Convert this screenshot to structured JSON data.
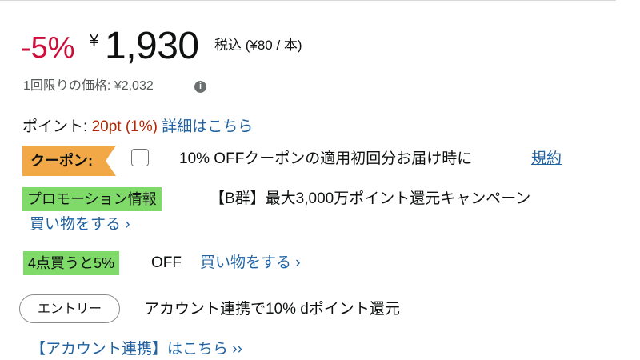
{
  "price": {
    "discount": "-5%",
    "currency_symbol": "¥",
    "amount": "1,930",
    "tax_note": "税込 (¥80 / 本)"
  },
  "one_time": {
    "label": "1回限りの価格:",
    "original_price": "¥2,032",
    "info_icon": "info-icon"
  },
  "points": {
    "label": "ポイント:",
    "value": "20pt",
    "percent": "(1%)",
    "details_link": "詳細はこちら"
  },
  "coupon": {
    "badge": "クーポン:",
    "checked": false,
    "text": "10% OFFクーポンの適用初回分お届け時に",
    "terms_link": "規約"
  },
  "promotion": {
    "badge": "プロモーション情報",
    "text": "【B群】最大3,000万ポイント還元キャンペーン",
    "shop_link": "買い物をする ›"
  },
  "bulk_deal": {
    "badge": "4点買うと5%",
    "off_text": "OFF",
    "shop_link": "買い物をする ›"
  },
  "entry": {
    "button_label": "エントリー",
    "text": "アカウント連携で10% dポイント還元",
    "account_link": "【アカウント連携】はこちら ››"
  },
  "colors": {
    "discount_red": "#cc0c39",
    "link_blue": "#2162a1",
    "coupon_orange": "#f3a847",
    "promo_green": "#7fda69"
  }
}
